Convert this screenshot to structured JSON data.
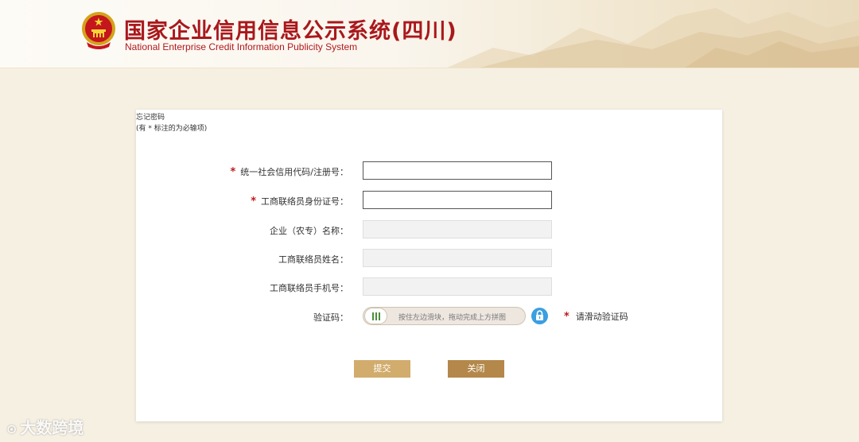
{
  "header": {
    "title": "国家企业信用信息公示系统(四川)",
    "subtitle": "National Enterprise Credit Information Publicity System",
    "emblem_icon": "national-emblem-icon",
    "title_color": "#a9181c"
  },
  "form": {
    "title": "忘记密码",
    "note": "(有 * 标注的为必输项)",
    "required_mark": "*",
    "fields": [
      {
        "label": "统一社会信用代码/注册号：",
        "required": true,
        "value": "",
        "enabled": true
      },
      {
        "label": "工商联络员身份证号：",
        "required": true,
        "value": "",
        "enabled": true
      },
      {
        "label": "企业（农专）名称：",
        "required": false,
        "value": "",
        "enabled": false
      },
      {
        "label": "工商联络员姓名：",
        "required": false,
        "value": "",
        "enabled": false
      },
      {
        "label": "工商联络员手机号：",
        "required": false,
        "value": "",
        "enabled": false
      }
    ],
    "captcha": {
      "label": "验证码：",
      "slider_text": "按住左边滑块，拖动完成上方拼图",
      "hint": "请滑动验证码",
      "lock_icon": "lock-icon",
      "handle_icon": "grip-icon"
    },
    "buttons": {
      "submit": "提交",
      "close": "关闭"
    }
  },
  "watermark": {
    "text": "大数跨境",
    "mark": "⊙"
  },
  "colors": {
    "background": "#f6f0e2",
    "accent_red": "#c0181d",
    "submit_button": "#d1ac6c",
    "close_button": "#b3884a",
    "lock_icon": "#3b9fe0"
  }
}
